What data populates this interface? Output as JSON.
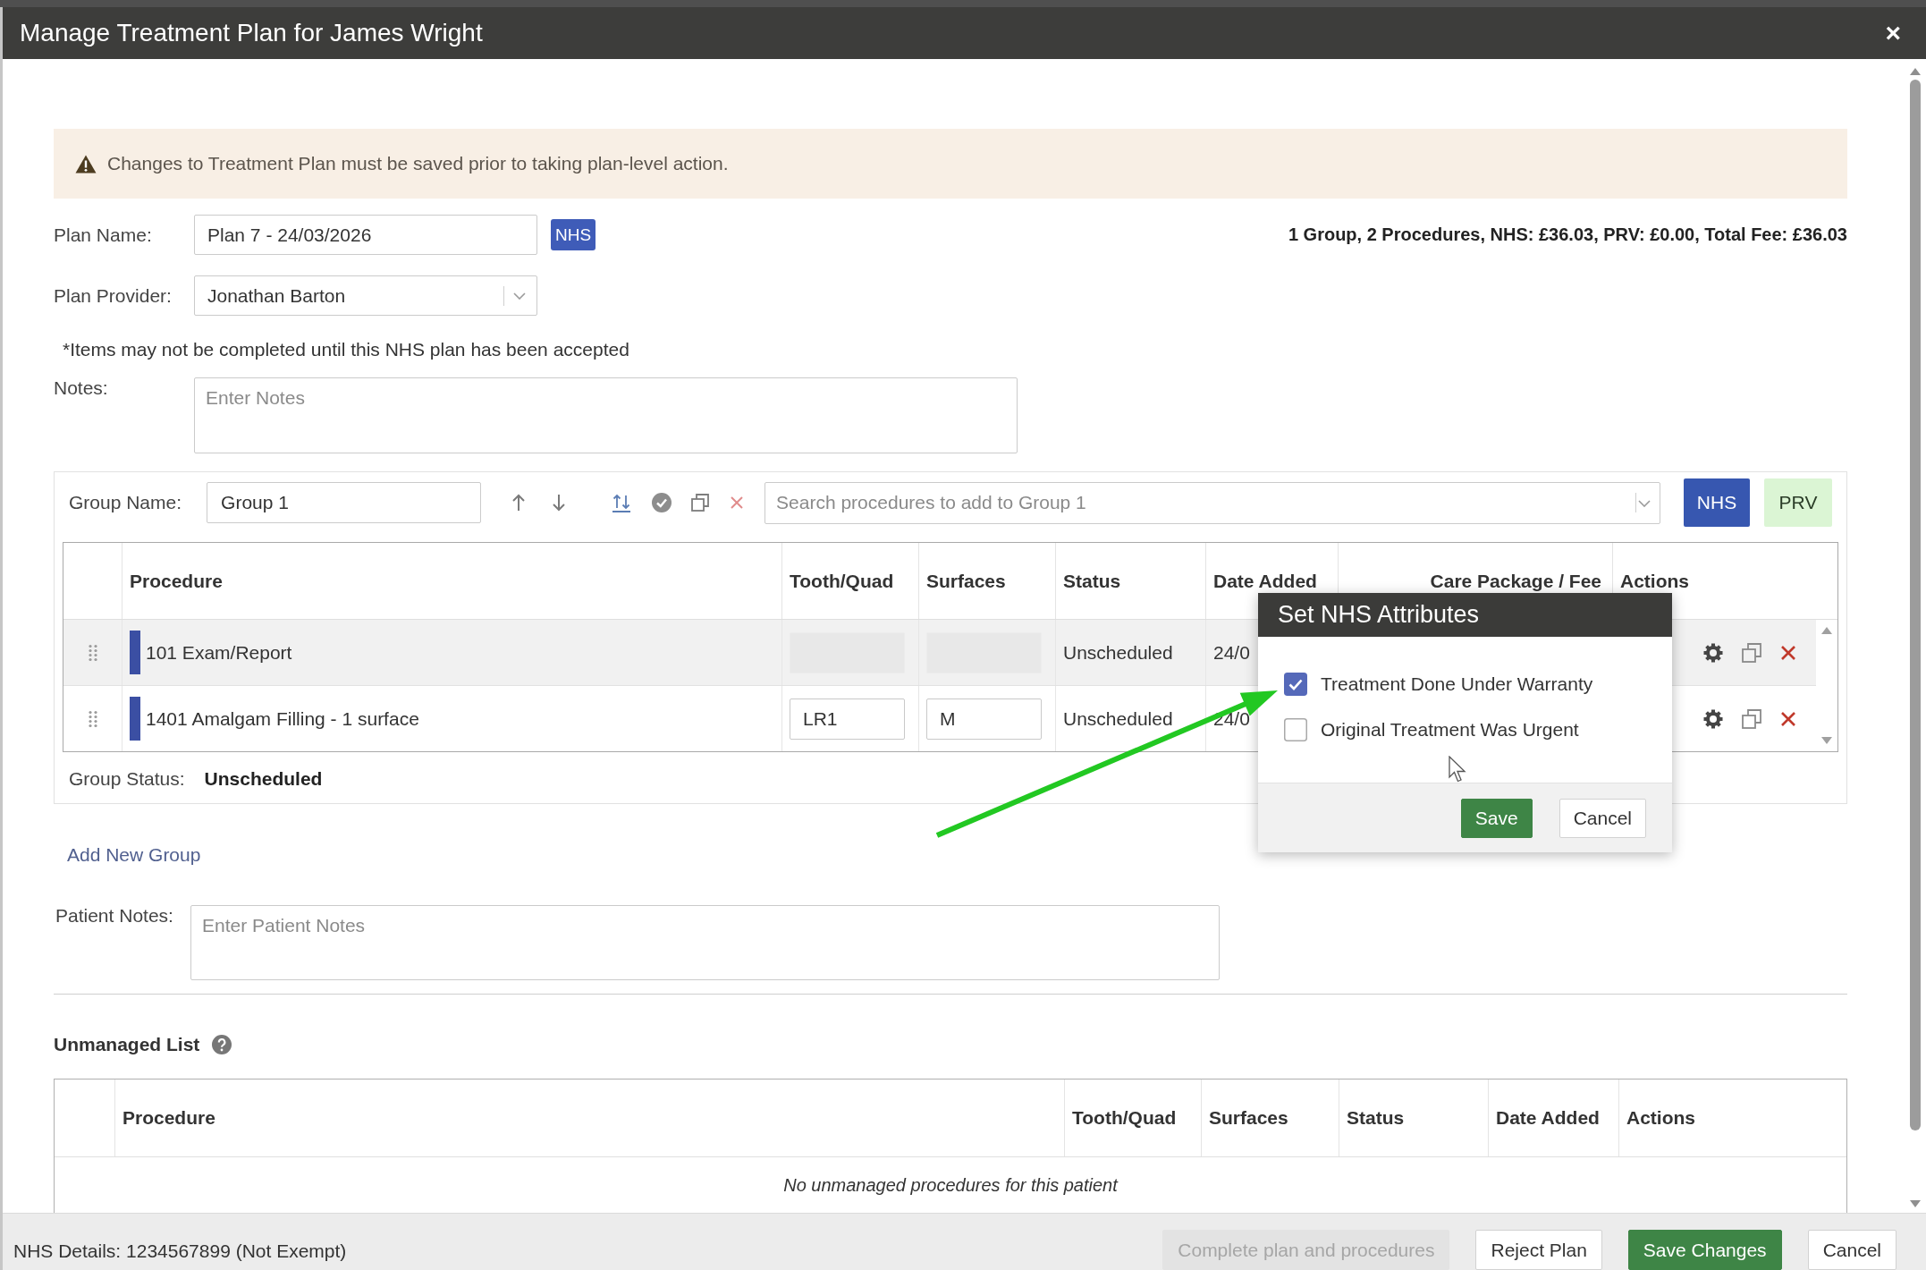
{
  "window": {
    "title": "Manage Treatment Plan for James Wright",
    "close": "×"
  },
  "notice": {
    "text": "Changes to Treatment Plan must be saved prior to taking plan-level action."
  },
  "plan": {
    "name_label": "Plan Name:",
    "name": "Plan 7 - 24/03/2026",
    "badge": "NHS",
    "summary": "1 Group, 2 Procedures, NHS: £36.03, PRV: £0.00, Total Fee: £36.03",
    "provider_label": "Plan Provider:",
    "provider": "Jonathan Barton",
    "disclaimer": "*Items may not be completed until this NHS plan has been accepted",
    "notes": {
      "label": "Notes:",
      "placeholder": "Enter Notes"
    }
  },
  "group": {
    "name_label": "Group Name:",
    "name": "Group 1",
    "search": {
      "placeholder": "Search procedures to add to Group 1"
    },
    "add_buttons": [
      {
        "label": "NHS",
        "kind": "nhs"
      },
      {
        "label": "PRV",
        "kind": "prv"
      }
    ],
    "table": {
      "columns": [
        "Procedure",
        "Tooth/Quad",
        "Surfaces",
        "Status",
        "Date Added",
        "Care Package / Fee",
        "Actions"
      ],
      "rows": [
        {
          "procedure": "101 Exam/Report",
          "color": "#3b4fa3",
          "highlighted": true,
          "tooth": {
            "disabled": true
          },
          "surfaces": {
            "disabled": true
          },
          "status": "Unscheduled",
          "date_added": "24/0"
        },
        {
          "procedure": "1401 Amalgam Filling - 1 surface",
          "color": "#3b4fa3",
          "highlighted": false,
          "tooth": {
            "value": "LR1",
            "disabled": false
          },
          "surfaces": {
            "value": "M",
            "disabled": false
          },
          "status": "Unscheduled",
          "date_added": "24/0"
        }
      ]
    },
    "status_label": "Group Status:",
    "status": "Unscheduled"
  },
  "nhs_attributes_popup": {
    "title": "Set NHS Attributes",
    "options": [
      {
        "label": "Treatment Done Under Warranty",
        "checked": true
      },
      {
        "label": "Original Treatment Was Urgent",
        "checked": false
      }
    ],
    "buttons": [
      {
        "label": "Save",
        "kind": "primary"
      },
      {
        "label": "Cancel",
        "kind": "secondary"
      }
    ]
  },
  "add_group_link": "Add New Group",
  "patient_notes": {
    "label": "Patient Notes:",
    "placeholder": "Enter Patient Notes"
  },
  "unmanaged": {
    "title": "Unmanaged List",
    "columns": [
      "Procedure",
      "Tooth/Quad",
      "Surfaces",
      "Status",
      "Date Added",
      "Actions"
    ],
    "empty_message": "No unmanaged procedures for this patient"
  },
  "footer": {
    "nhs_details": "NHS Details: 1234567899 (Not Exempt)",
    "buttons": [
      {
        "label": "Complete plan and procedures",
        "kind": "secondary",
        "disabled": true
      },
      {
        "label": "Reject Plan",
        "kind": "secondary",
        "disabled": false
      },
      {
        "label": "Save Changes",
        "kind": "primary",
        "disabled": false
      },
      {
        "label": "Cancel",
        "kind": "secondary",
        "disabled": false
      }
    ]
  }
}
